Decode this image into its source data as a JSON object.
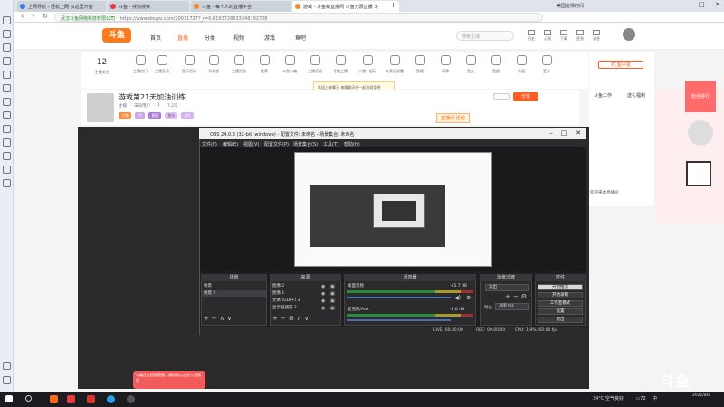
{
  "browser": {
    "tabs": [
      {
        "label": "上网导航 - 轻松上网 从这里开始",
        "active": false
      },
      {
        "label": "斗鱼 - 搜狗搜索",
        "active": false
      },
      {
        "label": "斗鱼 - 每个人的直播平台",
        "active": false
      },
      {
        "label": "游戏 - 斗鱼新直播间 斗鱼无限直播 斗",
        "active": true
      }
    ],
    "right_tab": "美国疫情时间",
    "site_label": "武汉斗鱼网络科技有限公司",
    "url": "https://www.douyu.com/10031727?_r=0.8193728933348792708"
  },
  "site": {
    "logo": "斗鱼",
    "nav": [
      "首页",
      "直播",
      "分类",
      "视频",
      "游戏",
      "鱼吧"
    ],
    "nav_active_index": 1,
    "search_placeholder": "搜索主播",
    "header_icons": [
      "历史",
      "订阅",
      "下载",
      "签到",
      "消息"
    ],
    "follow": {
      "count": "12",
      "label": "主播关注"
    },
    "categories": [
      "主播热门",
      "主播互动",
      "鱼乐活动",
      "节奏感",
      "主播活动",
      "推荐",
      "斗鱼小编",
      "主播活动",
      "寻找主播",
      "小猪一起玩",
      "大家说说看",
      "鱼塘",
      "表情",
      "鱼丸",
      "鱼翅",
      "乐园",
      "更多"
    ],
    "pc_button": "PC客户端",
    "dropdown_text": "欢迎上来聊天 来聊聊天吧一起说说话吧",
    "room_title": "游戏第21天加油训练",
    "room_meta": [
      "主播",
      "未知用户",
      "1",
      "7.2万"
    ],
    "room_tags": [
      "主播",
      "TV",
      "直播",
      "鱼乐",
      "送礼"
    ],
    "promo_button": "直播间 活动",
    "share_button": "分享",
    "right_panel_items": [
      "斗鱼工作",
      "送礼福利"
    ],
    "right_strip": [
      "关注",
      "主播",
      "活动"
    ],
    "rank_label": "粉丝排行",
    "welcome": "欢迎来本直播间",
    "floating_logo": "斗鱼",
    "chat_bubble": "小编正在搭建直播，请稍候点击进入直播间"
  },
  "obs": {
    "title": "OBS 24.0.3 (32-bit, windows) - 配置文件: 未命名 - 场景集合: 未命名",
    "menu": [
      "文件(F)",
      "编辑(E)",
      "视图(V)",
      "配置文件(P)",
      "场景集合(S)",
      "工具(T)",
      "帮助(H)"
    ],
    "docks": {
      "scenes": {
        "title": "场景",
        "items": [
          "场景",
          "场景 2"
        ],
        "selected": 1
      },
      "sources": {
        "title": "来源",
        "items": [
          "图像 2",
          "图像 1",
          "文本 (GDI+) 3",
          "显示器捕获 2"
        ]
      },
      "mixer": {
        "title": "混音器",
        "channels": [
          {
            "name": "桌面音频",
            "db": "-15.7 dB",
            "level": 0.7
          },
          {
            "name": "麦克风/Aux",
            "db": "-5.6 dB",
            "level": 0.85
          }
        ]
      },
      "transitions": {
        "title": "场景过渡",
        "type": "淡出",
        "duration_label": "时长",
        "duration": "300 ms"
      },
      "controls": {
        "title": "控件",
        "buttons": [
          "开始推流",
          "开始录制",
          "工作室模式",
          "设置",
          "退出"
        ],
        "highlighted": 0
      }
    },
    "status": [
      "LIVE: 00:00:00",
      "REC: 00:00:00",
      "CPU: 1.9%, 60.00 fps"
    ]
  },
  "taskbar": {
    "weather": "34°C 空气良好",
    "battery": "72",
    "time": "",
    "date": "2021/8/8",
    "ime": "中"
  },
  "colors": {
    "brand": "#ff5d23",
    "obs_bg": "#1f1f22"
  }
}
